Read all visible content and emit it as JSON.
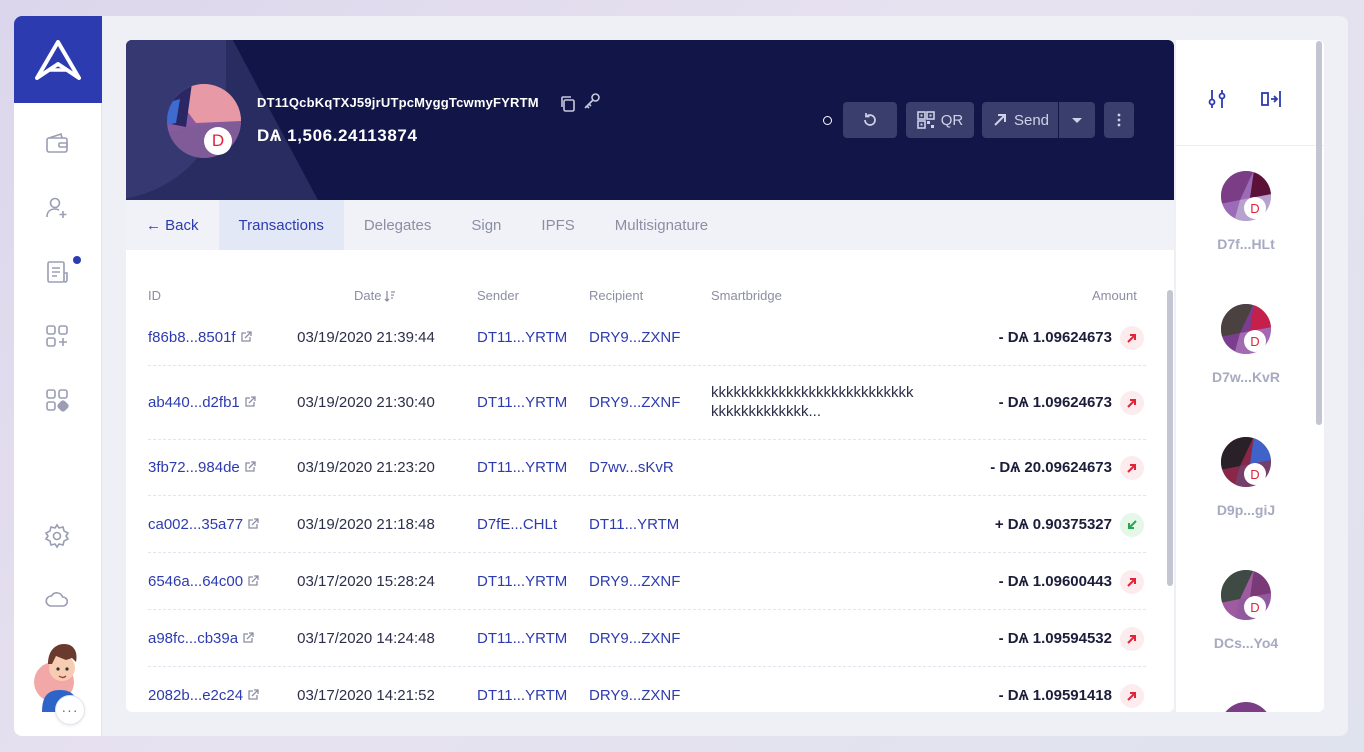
{
  "wallet": {
    "address": "DT11QcbKqTXJ59jrUTpcMyggTcwmyFYRTM",
    "balance": "DѦ 1,506.24113874",
    "avatar_letter": "D"
  },
  "header_buttons": {
    "qr_label": "QR",
    "send_label": "Send"
  },
  "tabs": [
    {
      "label": "← Back"
    },
    {
      "label": "Transactions"
    },
    {
      "label": "Delegates"
    },
    {
      "label": "Sign"
    },
    {
      "label": "IPFS"
    },
    {
      "label": "Multisignature"
    }
  ],
  "table": {
    "headers": {
      "id": "ID",
      "date": "Date",
      "sender": "Sender",
      "recipient": "Recipient",
      "smartbridge": "Smartbridge",
      "amount": "Amount"
    },
    "rows": [
      {
        "id": "f86b8...8501f",
        "date": "03/19/2020 21:39:44",
        "sender": "DT11...YRTM",
        "recipient": "DRY9...ZXNF",
        "smartbridge": "",
        "smartbridge2": "",
        "amount": "- DѦ 1.09624673",
        "direction": "out"
      },
      {
        "id": "ab440...d2fb1",
        "date": "03/19/2020 21:30:40",
        "sender": "DT11...YRTM",
        "recipient": "DRY9...ZXNF",
        "smartbridge": "kkkkkkkkkkkkkkkkkkkkkkkkkkk",
        "smartbridge2": "kkkkkkkkkkkkk...",
        "amount": "- DѦ 1.09624673",
        "direction": "out"
      },
      {
        "id": "3fb72...984de",
        "date": "03/19/2020 21:23:20",
        "sender": "DT11...YRTM",
        "recipient": "D7wv...sKvR",
        "smartbridge": "",
        "smartbridge2": "",
        "amount": "- DѦ 20.09624673",
        "direction": "out"
      },
      {
        "id": "ca002...35a77",
        "date": "03/19/2020 21:18:48",
        "sender": "D7fE...CHLt",
        "recipient": "DT11...YRTM",
        "smartbridge": "",
        "smartbridge2": "",
        "amount": "+ DѦ 0.90375327",
        "direction": "in"
      },
      {
        "id": "6546a...64c00",
        "date": "03/17/2020 15:28:24",
        "sender": "DT11...YRTM",
        "recipient": "DRY9...ZXNF",
        "smartbridge": "",
        "smartbridge2": "",
        "amount": "- DѦ 1.09600443",
        "direction": "out"
      },
      {
        "id": "a98fc...cb39a",
        "date": "03/17/2020 14:24:48",
        "sender": "DT11...YRTM",
        "recipient": "DRY9...ZXNF",
        "smartbridge": "",
        "smartbridge2": "",
        "amount": "- DѦ 1.09594532",
        "direction": "out"
      },
      {
        "id": "2082b...e2c24",
        "date": "03/17/2020 14:21:52",
        "sender": "DT11...YRTM",
        "recipient": "DRY9...ZXNF",
        "smartbridge": "",
        "smartbridge2": "",
        "amount": "- DѦ 1.09591418",
        "direction": "out"
      }
    ]
  },
  "wallets_panel": [
    {
      "name": "D7f...HLt",
      "letter": "D"
    },
    {
      "name": "D7w...KvR",
      "letter": "D"
    },
    {
      "name": "D9p...giJ",
      "letter": "D"
    },
    {
      "name": "DCs...Yo4",
      "letter": "D"
    }
  ],
  "more_label": "···",
  "colors": {
    "accent": "#2d3bb0",
    "header_bg": "#111547",
    "outgoing": "#e0243a",
    "incoming": "#27a64b"
  },
  "icons": [
    "wallet-icon",
    "add-contact-icon",
    "announcements-icon",
    "plugin-add-icon",
    "plugin-manager-icon",
    "settings-icon",
    "network-cloud-icon",
    "copy-icon",
    "key-icon",
    "refresh-icon",
    "qr-icon",
    "send-icon",
    "chevron-down-icon",
    "more-vertical-icon",
    "sort-icon",
    "external-link-icon",
    "sliders-icon",
    "expand-icon"
  ]
}
